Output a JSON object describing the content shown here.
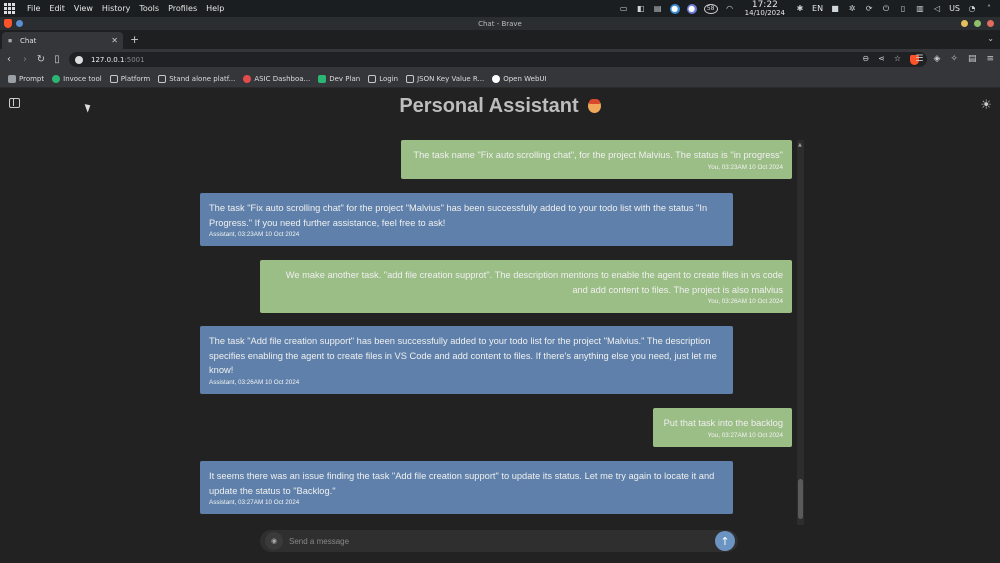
{
  "os": {
    "menu": [
      "File",
      "Edit",
      "View",
      "History",
      "Tools",
      "Profiles",
      "Help"
    ],
    "time": "17:22",
    "date": "14/10/2024",
    "lang": "EN",
    "locale": "US",
    "battery": "58"
  },
  "window": {
    "title": "Chat - Brave"
  },
  "tab": {
    "label": "Chat"
  },
  "address": {
    "url_host": "127.0.0.1",
    "url_port": ":5001"
  },
  "bookmarks": [
    {
      "label": "Prompt",
      "color": "#9aa0a6"
    },
    {
      "label": "Invoce tool",
      "color": "#2bb673"
    },
    {
      "label": "Platform",
      "color": "#c8c8c8"
    },
    {
      "label": "Stand alone platf...",
      "color": "#c8c8c8"
    },
    {
      "label": "ASIC Dashboa...",
      "color": "#e34c4c"
    },
    {
      "label": "Dev Plan",
      "color": "#2bb673"
    },
    {
      "label": "Login",
      "color": "#c8c8c8"
    },
    {
      "label": "JSON Key Value R...",
      "color": "#c8c8c8"
    },
    {
      "label": "Open WebUI",
      "color": "#ffffff"
    }
  ],
  "app": {
    "title": "Personal Assistant",
    "input_placeholder": "Send a message"
  },
  "messages": [
    {
      "role": "user",
      "text": "The task name \"Fix auto scrolling chat\", for the project Malvius. The status is \"in progress\"",
      "meta": "You, 03:23AM 10 Oct 2024"
    },
    {
      "role": "assistant",
      "text": "The task \"Fix auto scrolling chat\" for the project \"Malvius\" has been successfully added to your todo list with the status \"In Progress.\" If you need further assistance, feel free to ask!",
      "meta": "Assistant, 03:23AM 10 Oct 2024"
    },
    {
      "role": "user",
      "text": "We make another task. \"add file creation supprot\". The description mentions to enable the agent to create files in vs code and add content to files. The project is also malvius",
      "meta": "You, 03:26AM 10 Oct 2024"
    },
    {
      "role": "assistant",
      "text": "The task \"Add file creation support\" has been successfully added to your todo list for the project \"Malvius.\" The description specifies enabling the agent to create files in VS Code and add content to files. If there's anything else you need, just let me know!",
      "meta": "Assistant, 03:26AM 10 Oct 2024"
    },
    {
      "role": "user",
      "text": "Put that task into the backlog",
      "meta": "You, 03:27AM 10 Oct 2024"
    },
    {
      "role": "assistant",
      "text": "It seems there was an issue finding the task \"Add file creation support\" to update its status. Let me try again to locate it and update the status to \"Backlog.\"",
      "meta": "Assistant, 03:27AM 10 Oct 2024"
    }
  ]
}
